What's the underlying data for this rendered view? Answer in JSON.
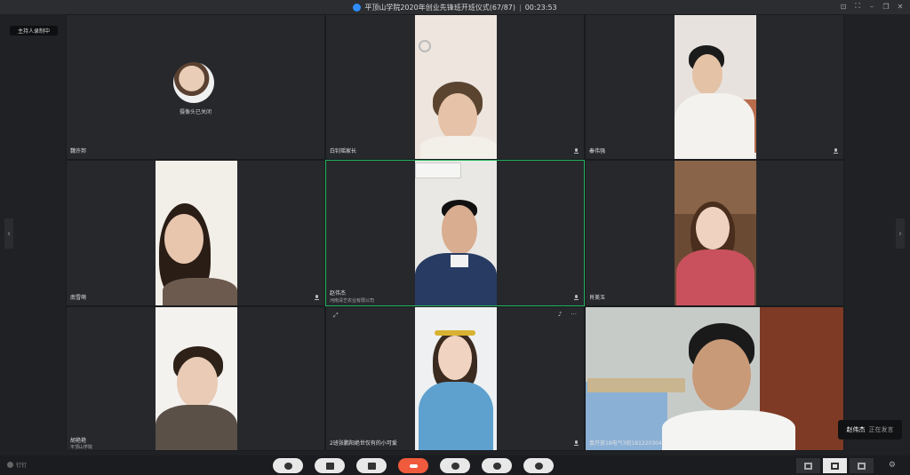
{
  "window": {
    "title": "平顶山学院2020年创业先锋班开班仪式(67/87)",
    "timer": "00:23:53"
  },
  "recording_badge": "主持人录制中",
  "tiles": [
    {
      "name": "魏许邦",
      "camera_status": "摄像头已关闭"
    },
    {
      "name": "白钊瑶家长"
    },
    {
      "name": "秦伟强"
    },
    {
      "name": "南雪萌"
    },
    {
      "name": "赵伟杰",
      "subtitle": "河南清艺农业有限公司"
    },
    {
      "name": "肖美玉"
    },
    {
      "name": "胡艳艳",
      "subtitle": "平顶山学院"
    },
    {
      "name": "2班张鹏阳绝世仅有的小可爱"
    },
    {
      "name": "袁开放18电气3班181220304"
    }
  ],
  "speaking": {
    "who": "赵伟杰",
    "status": "正在发言"
  },
  "brand": "钉钉",
  "icons": [
    "mic-icon",
    "camera-icon",
    "share-screen-icon",
    "hangup-icon",
    "add-member-icon",
    "members-icon",
    "record-icon",
    "grid-layout-icon",
    "list-layout-icon",
    "settings-icon"
  ]
}
